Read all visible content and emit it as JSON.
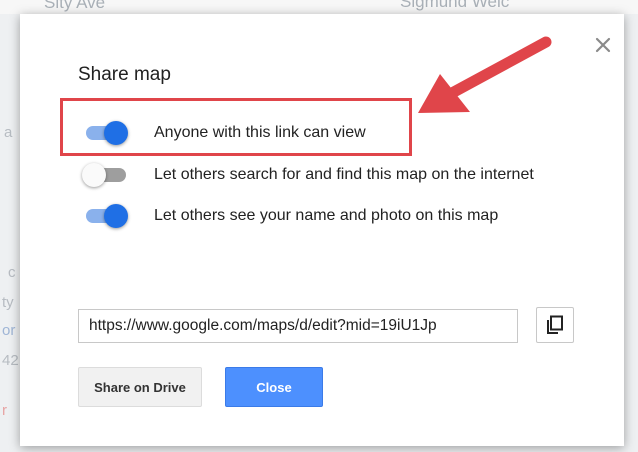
{
  "background": {
    "street_left": "Sity Ave",
    "street_right": "Sigmund Welc",
    "side_fragments": [
      "a",
      "c",
      "ty",
      "or",
      "42",
      "r"
    ]
  },
  "dialog": {
    "title": "Share map",
    "options": [
      {
        "label": "Anyone with this link can view",
        "on": true,
        "highlighted": true
      },
      {
        "label": "Let others search for and find this map on the internet",
        "on": false
      },
      {
        "label": "Let others see your name and photo on this map",
        "on": true
      }
    ],
    "link_value": "https://www.google.com/maps/d/edit?mid=19iU1Jp",
    "share_drive_label": "Share on Drive",
    "close_label": "Close"
  },
  "colors": {
    "accent_blue": "#4d90fe",
    "toggle_on": "#1f6fe5",
    "annotation_red": "#e0454a"
  }
}
